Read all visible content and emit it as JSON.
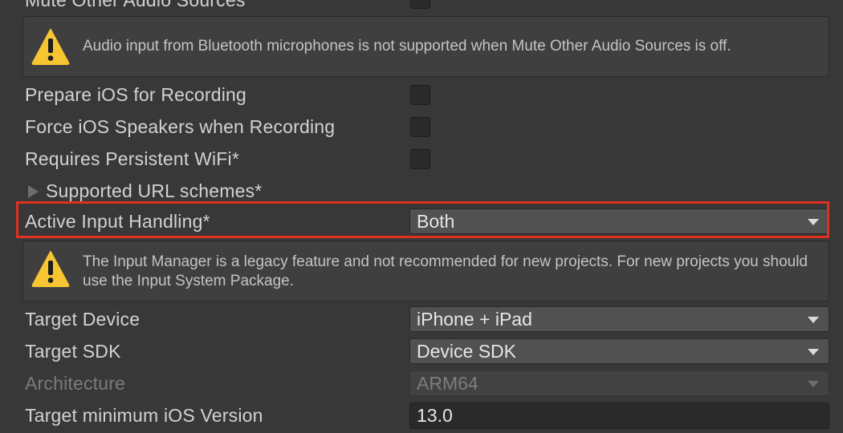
{
  "settings": {
    "mute_other_audio": {
      "label": "Mute Other Audio Sources"
    },
    "bluetooth_warning": "Audio input from Bluetooth microphones is not supported when Mute Other Audio Sources is off.",
    "prepare_ios_recording": {
      "label": "Prepare iOS for Recording",
      "checked": false
    },
    "force_ios_speakers": {
      "label": "Force iOS Speakers when Recording",
      "checked": false
    },
    "requires_persistent_wifi": {
      "label": "Requires Persistent WiFi*",
      "checked": false
    },
    "supported_url_schemes": {
      "label": "Supported URL schemes*",
      "expanded": false
    },
    "active_input_handling": {
      "label": "Active Input Handling*",
      "value": "Both"
    },
    "input_manager_warning": "The Input Manager is a legacy feature and not recommended for new projects. For new projects you should use the Input System Package.",
    "target_device": {
      "label": "Target Device",
      "value": "iPhone + iPad"
    },
    "target_sdk": {
      "label": "Target SDK",
      "value": "Device SDK"
    },
    "architecture": {
      "label": "Architecture",
      "value": "ARM64",
      "disabled": true
    },
    "target_min_ios": {
      "label": "Target minimum iOS Version",
      "value": "13.0"
    }
  },
  "icons": {
    "warning": "warning-icon",
    "foldout": "triangle-right-icon",
    "dropdown": "chevron-down-icon"
  },
  "colors": {
    "highlight": "#e0301e",
    "warning_yellow": "#f7c531",
    "background": "#383838"
  }
}
